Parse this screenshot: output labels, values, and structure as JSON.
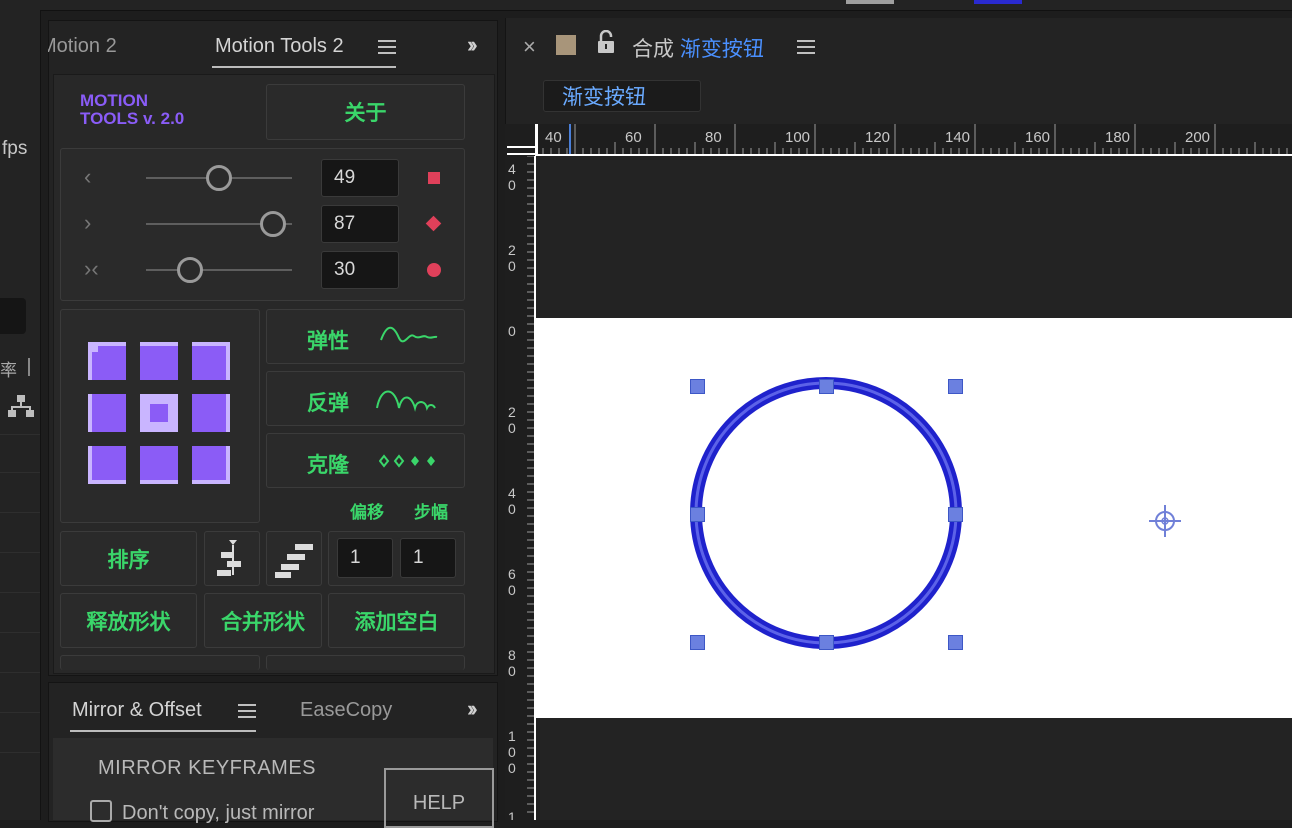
{
  "left_panel": {
    "fps_label": "fps",
    "rate_label": "率"
  },
  "motion_tools": {
    "tabs": [
      {
        "label": "Motion 2"
      },
      {
        "label": "Motion Tools 2",
        "active": true
      }
    ],
    "logo_line1": "MOTION",
    "logo_line2": "TOOLS v. 2.0",
    "about_label": "关于",
    "sliders": [
      {
        "icon": "chevron-left",
        "value": "49",
        "level": 0.5,
        "marker": "square"
      },
      {
        "icon": "chevron-right",
        "value": "87",
        "level": 0.87,
        "marker": "diamond"
      },
      {
        "icon": "collapse-arrows",
        "value": "30",
        "level": 0.3,
        "marker": "circle"
      }
    ],
    "marker_color": "#e0405a",
    "accent_color": "#3ad66a",
    "anchor_grid_color": "#8b5cf6",
    "effects": [
      {
        "label": "弹性",
        "icon": "elastic-wave"
      },
      {
        "label": "反弹",
        "icon": "bounce-arcs"
      },
      {
        "label": "克隆",
        "icon": "clone-dots"
      }
    ],
    "offset_label": "偏移",
    "step_label": "步幅",
    "sort_label": "排序",
    "offset_value": "1",
    "step_value": "1",
    "bottom_buttons": [
      {
        "label": "释放形状"
      },
      {
        "label": "合并形状"
      },
      {
        "label": "添加空白"
      }
    ]
  },
  "mirror_panel": {
    "tabs": [
      {
        "label": "Mirror & Offset",
        "active": true
      },
      {
        "label": "EaseCopy"
      }
    ],
    "heading": "MIRROR KEYFRAMES",
    "checkbox_label": "Don't copy, just mirror",
    "checkbox_checked": false,
    "help_label": "HELP"
  },
  "composition": {
    "close_glyph": "×",
    "tab_prefix": "合成",
    "tab_name": "渐变按钮",
    "name_box": "渐变按钮",
    "name_color": "#4a90ff",
    "h_ruler": [
      "40",
      "60",
      "80",
      "100",
      "120",
      "140",
      "160",
      "180",
      "200"
    ],
    "v_ruler": [
      "40",
      "20",
      "0",
      "20",
      "40",
      "60",
      "80",
      "100",
      "1"
    ],
    "circle_color": "#1f22cc",
    "handle_color": "#6b80e0"
  }
}
